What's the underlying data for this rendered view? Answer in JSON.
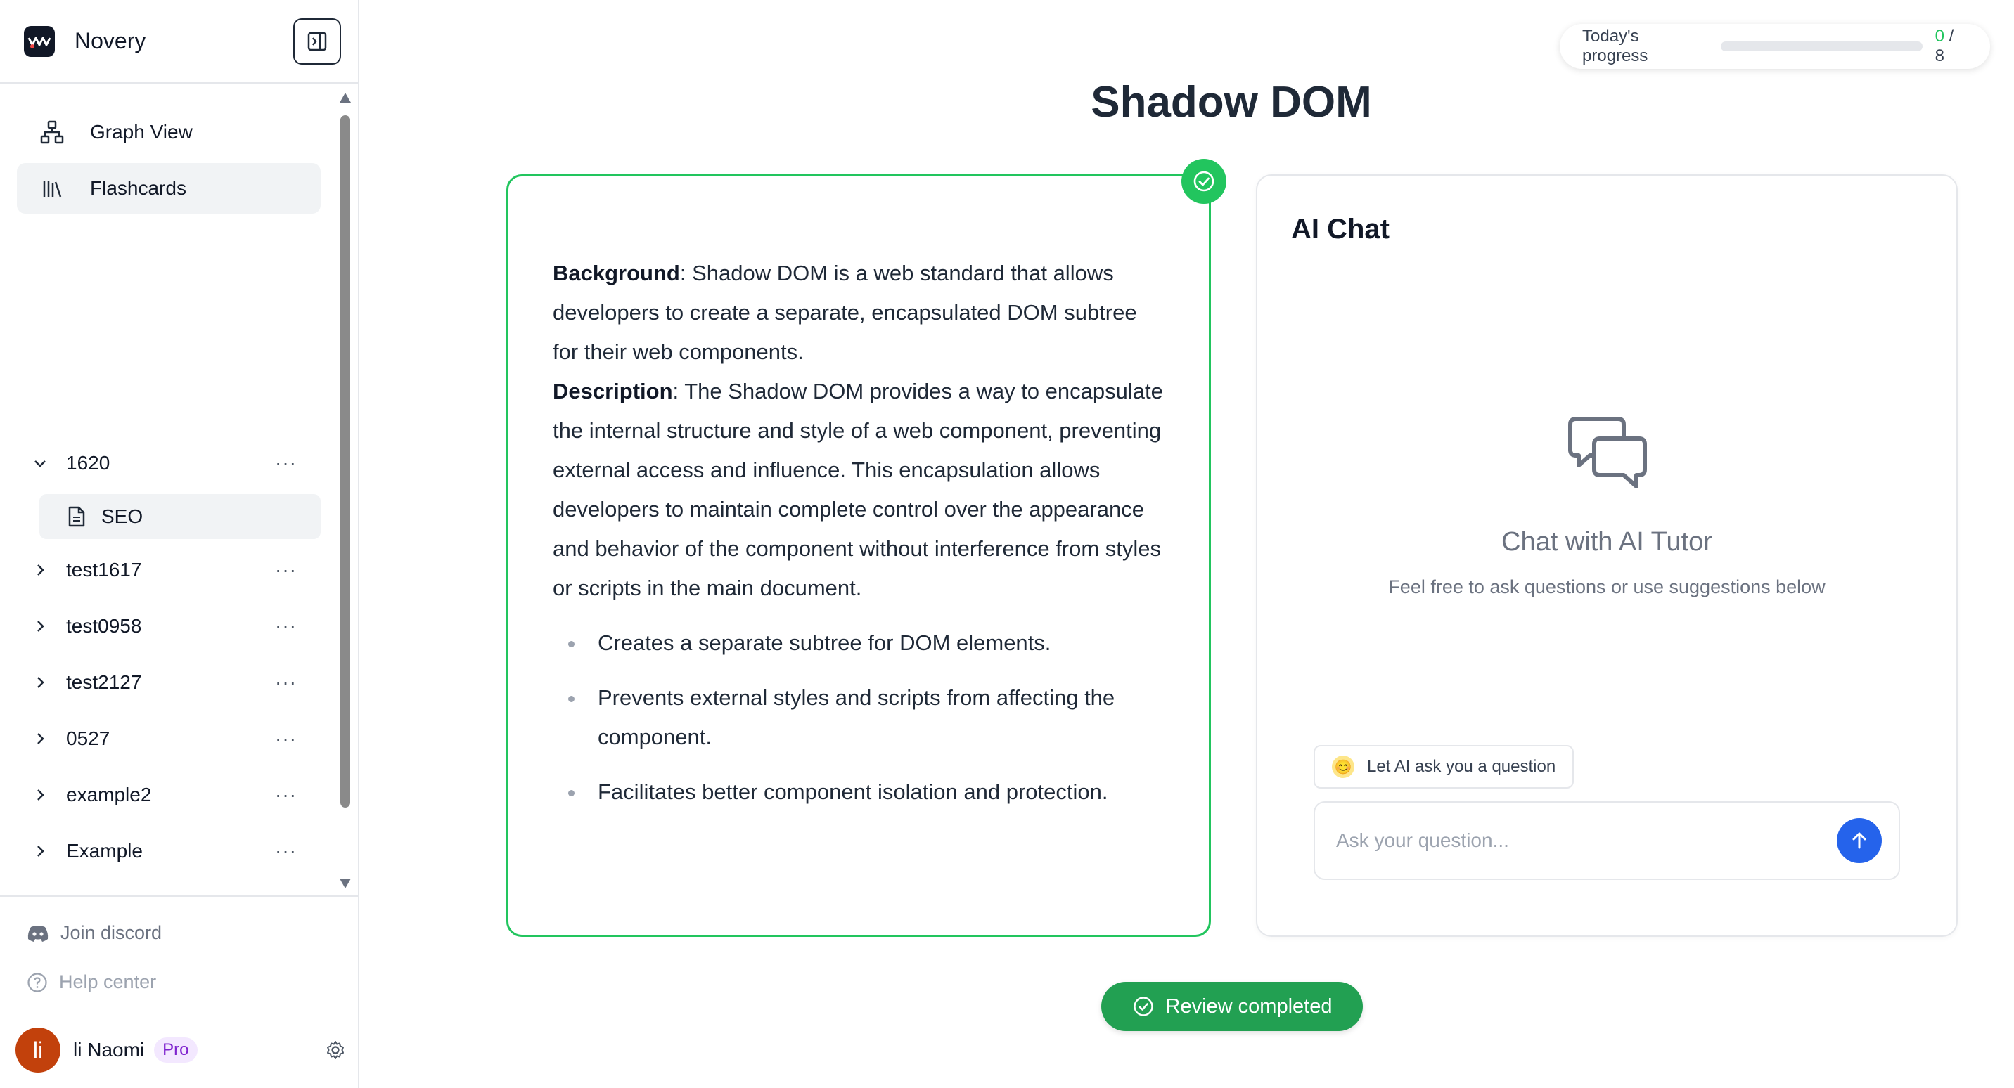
{
  "app": {
    "name": "Novery"
  },
  "sidebar": {
    "nav": [
      {
        "label": "Graph View",
        "icon": "graph-icon"
      },
      {
        "label": "Flashcards",
        "icon": "library-icon",
        "active": true
      }
    ],
    "tree": [
      {
        "label": "1620",
        "expanded": true,
        "children": [
          {
            "label": "SEO",
            "icon": "document-icon"
          }
        ]
      },
      {
        "label": "test1617"
      },
      {
        "label": "test0958"
      },
      {
        "label": "test2127"
      },
      {
        "label": "0527"
      },
      {
        "label": "example2"
      },
      {
        "label": "Example"
      }
    ],
    "more_glyph": "···",
    "footer": {
      "discord": "Join discord",
      "help": "Help center",
      "user": {
        "initial": "li",
        "name": "li Naomi",
        "plan": "Pro"
      }
    }
  },
  "progress": {
    "label": "Today's progress",
    "done": "0",
    "total": "8",
    "sep": " / ",
    "fraction": 0
  },
  "page": {
    "title": "Shadow DOM"
  },
  "card": {
    "background_label": "Background",
    "background_text": ": Shadow DOM is a web standard that allows developers to create a separate, encapsulated DOM subtree for their web components.",
    "description_label": "Description",
    "description_text": ": The Shadow DOM provides a way to encapsulate the internal structure and style of a web component, preventing external access and influence. This encapsulation allows developers to maintain complete control over the appearance and behavior of the component without interference from styles or scripts in the main document.",
    "bullets": [
      "Creates a separate subtree for DOM elements.",
      "Prevents external styles and scripts from affecting the component.",
      "Facilitates better component isolation and protection."
    ]
  },
  "chat": {
    "title": "AI Chat",
    "heading": "Chat with AI Tutor",
    "subheading": "Feel free to ask questions or use suggestions below",
    "suggestion": "Let AI ask you a question",
    "suggestion_emoji": "😊",
    "input_placeholder": "Ask your question..."
  },
  "review": {
    "label": "Review completed"
  },
  "colors": {
    "accent_green": "#22c55e",
    "button_green": "#22a052",
    "send_blue": "#2563eb",
    "avatar": "#c2410c"
  }
}
